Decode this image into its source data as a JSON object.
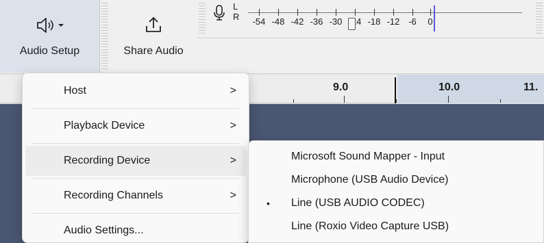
{
  "toolbar": {
    "audio_setup_label": "Audio Setup",
    "share_audio_label": "Share Audio",
    "meter": {
      "left_channel": "L",
      "right_channel": "R",
      "ticks": [
        "-54",
        "-48",
        "-42",
        "-36",
        "-30",
        "-24",
        "-18",
        "-12",
        "-6",
        "0"
      ]
    }
  },
  "ruler": {
    "labels": [
      "9.0",
      "10.0",
      "11."
    ]
  },
  "main_menu": {
    "items": [
      {
        "label": "Host",
        "submenu": true
      },
      {
        "label": "Playback Device",
        "submenu": true
      },
      {
        "label": "Recording Device",
        "submenu": true,
        "highlighted": true
      },
      {
        "label": "Recording Channels",
        "submenu": true
      },
      {
        "label": "Audio Settings...",
        "submenu": false
      }
    ],
    "submenu_arrow": ">"
  },
  "recording_device_menu": {
    "items": [
      {
        "label": "Microsoft Sound Mapper - Input",
        "selected": false
      },
      {
        "label": "Microphone (USB Audio Device)",
        "selected": false
      },
      {
        "label": "Line (USB AUDIO  CODEC)",
        "selected": true
      },
      {
        "label": "Line (Roxio Video Capture USB)",
        "selected": false
      }
    ],
    "selected_marker": "•"
  },
  "colors": {
    "track_background": "#4a5672",
    "selection": "#cfd9e6",
    "button_active": "#dbe2ec"
  }
}
